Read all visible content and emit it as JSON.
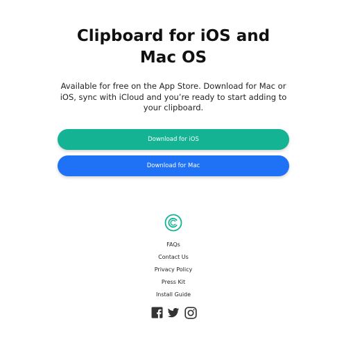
{
  "hero": {
    "title": "Clipboard for iOS and Mac OS",
    "subtitle": "Available for free on the App Store. Download for Mac or iOS, sync with iCloud and you’re ready to start adding to your clipboard."
  },
  "buttons": {
    "ios_label": "Download for iOS",
    "mac_label": "Download for Mac"
  },
  "footer": {
    "logo_icon": "clipboard-logo-icon",
    "links": [
      "FAQs",
      "Contact Us",
      "Privacy Policy",
      "Press Kit",
      "Install Guide"
    ],
    "social": [
      "facebook-icon",
      "twitter-icon",
      "instagram-icon"
    ]
  },
  "colors": {
    "ios_button": "#14b394",
    "mac_button": "#1f72f6",
    "logo": "#14b394"
  }
}
